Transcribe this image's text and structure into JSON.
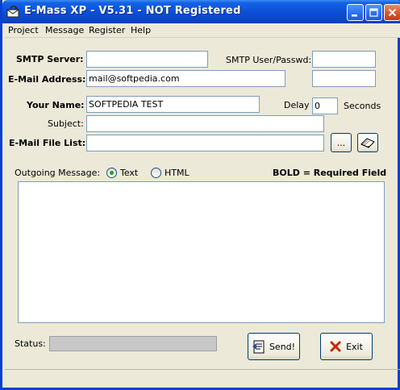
{
  "window": {
    "title": "E-Mass XP  -  V5.31  -  NOT Registered"
  },
  "menu": {
    "items": [
      "Project",
      "Message",
      "Register",
      "Help"
    ]
  },
  "form": {
    "smtp_server_label": "SMTP Server:",
    "smtp_server_value": "",
    "smtp_user_label": "SMTP User/Passwd:",
    "smtp_user_value": "",
    "smtp_pass_value": "",
    "email_label": "E-Mail Address:",
    "email_value": "mail@softpedia.com",
    "your_name_label": "Your Name:",
    "your_name_value": "SOFTPEDIA TEST",
    "delay_label": "Delay",
    "delay_value": "0",
    "seconds_label": "Seconds",
    "subject_label": "Subject:",
    "subject_value": "",
    "file_list_label": "E-Mail File List:",
    "file_list_value": "",
    "browse_label": "..."
  },
  "message": {
    "label": "Outgoing Message:",
    "format_text": "Text",
    "format_html": "HTML",
    "selected_format": "Text",
    "required_note": "BOLD = Required Field",
    "body": ""
  },
  "status": {
    "label": "Status:",
    "value": ""
  },
  "buttons": {
    "send": "Send!",
    "exit": "Exit"
  },
  "colors": {
    "titlebar": "#0a4fd6",
    "window_bg": "#ece9d8",
    "exit_icon": "#cc2200",
    "radio_dot": "#21a121"
  },
  "icons": [
    "envelope-app-icon",
    "minimize-icon",
    "maximize-icon",
    "close-icon",
    "open-book-icon",
    "send-document-icon",
    "exit-x-icon"
  ]
}
